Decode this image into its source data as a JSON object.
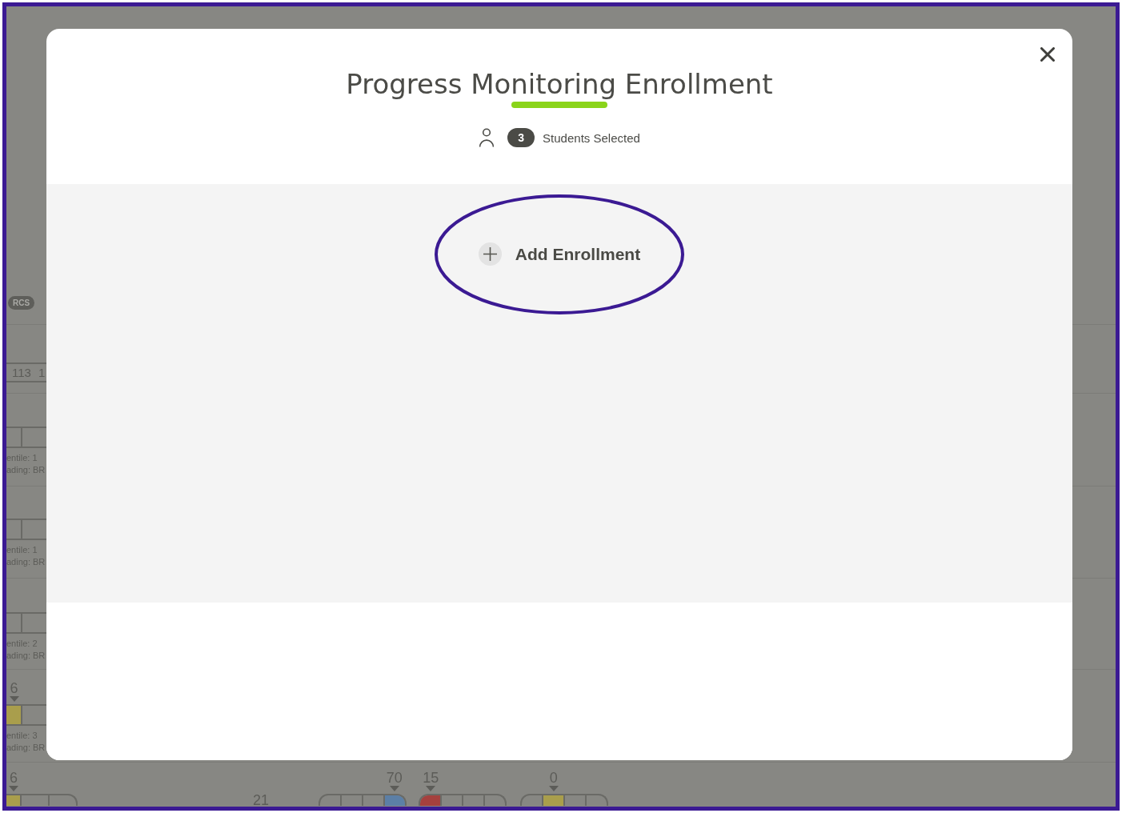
{
  "annotation_frame": true,
  "background": {
    "tag": "RCS",
    "rows": [
      {
        "kind": "numbers",
        "values": [
          "113",
          "1"
        ]
      },
      {
        "kind": "bar",
        "bar": {
          "segments": [
            {
              "filled": false
            },
            {
              "filled": false
            }
          ]
        },
        "details": [
          "entile: 1",
          "ading: BR"
        ]
      },
      {
        "kind": "bar",
        "bar": {
          "segments": [
            {
              "filled": false
            },
            {
              "filled": false
            }
          ]
        },
        "details": [
          "entile: 1",
          "ading: BR"
        ]
      },
      {
        "kind": "bar",
        "bar": {
          "segments": [
            {
              "filled": false
            },
            {
              "filled": false
            }
          ]
        },
        "details": [
          "entile: 2",
          "ading: BR"
        ]
      },
      {
        "kind": "bar",
        "bar": {
          "marker": "6",
          "color": "#a99e4c",
          "segments": [
            {
              "filled": true
            },
            {
              "filled": false
            }
          ]
        },
        "details": [
          "entile: 3",
          "ading: BR"
        ]
      }
    ],
    "bottom_row": [
      {
        "kind": "bar",
        "marker": "6",
        "color": "#a99e4c",
        "segments": [
          {
            "filled": true
          },
          {
            "filled": false
          },
          {
            "filled": false
          }
        ]
      },
      {
        "kind": "number",
        "value": "21"
      },
      {
        "kind": "bar",
        "marker": "70",
        "color": "#5c7fa6",
        "segments": [
          {
            "filled": false
          },
          {
            "filled": false
          },
          {
            "filled": false
          },
          {
            "filled": true
          }
        ]
      },
      {
        "kind": "bar",
        "marker": "15",
        "color": "#a5403e",
        "segments": [
          {
            "filled": true
          },
          {
            "filled": false
          },
          {
            "filled": false
          },
          {
            "filled": false
          }
        ]
      },
      {
        "kind": "bar",
        "marker": "0",
        "color": "#a99e4c",
        "segments": [
          {
            "filled": false
          },
          {
            "filled": true
          },
          {
            "filled": false
          },
          {
            "filled": false
          }
        ]
      }
    ]
  },
  "modal": {
    "title": "Progress Monitoring Enrollment",
    "selection": {
      "count": "3",
      "label": "Students Selected"
    },
    "add_enrollment": {
      "label": "Add Enrollment",
      "circled": true
    }
  }
}
